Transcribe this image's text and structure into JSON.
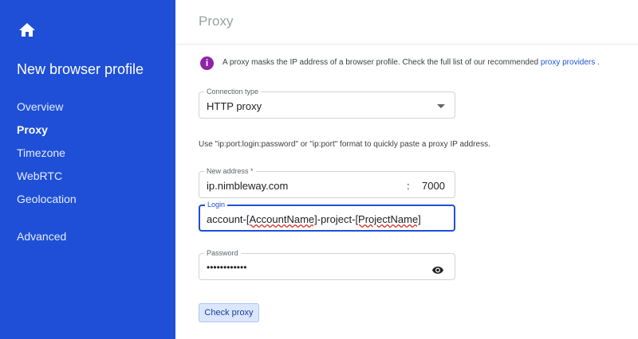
{
  "sidebar": {
    "title": "New browser profile",
    "items": [
      {
        "label": "Overview"
      },
      {
        "label": "Proxy"
      },
      {
        "label": "Timezone"
      },
      {
        "label": "WebRTC"
      },
      {
        "label": "Geolocation"
      },
      {
        "label": "Advanced"
      }
    ],
    "active_item": "Proxy",
    "home_icon": "home-icon"
  },
  "main": {
    "title": "Proxy",
    "info": {
      "text": "A proxy masks the IP address of a browser profile. Check the full list of our recommended ",
      "link": "proxy providers",
      "suffix": " .",
      "icon": "info-icon"
    },
    "connection_type": {
      "label": "Connection type",
      "value": "HTTP proxy"
    },
    "help_text": "Use \"ip:port:login:password\" or \"ip:port\" format to quickly paste a proxy IP address.",
    "address": {
      "label": "New address *",
      "value": "ip.nimbleway.com",
      "separator": ":",
      "port": "7000"
    },
    "login": {
      "label": "Login",
      "prefix": "account-",
      "account": "[AccountName]",
      "middle": "-project-",
      "project": "[ProjectName]"
    },
    "password": {
      "label": "Password",
      "value": "••••••••••••"
    },
    "check_button": "Check proxy"
  },
  "colors": {
    "sidebar_bg": "#1e4fd6",
    "accent": "#1e4fd6",
    "info_icon": "#8e24aa",
    "link": "#1a56db"
  }
}
